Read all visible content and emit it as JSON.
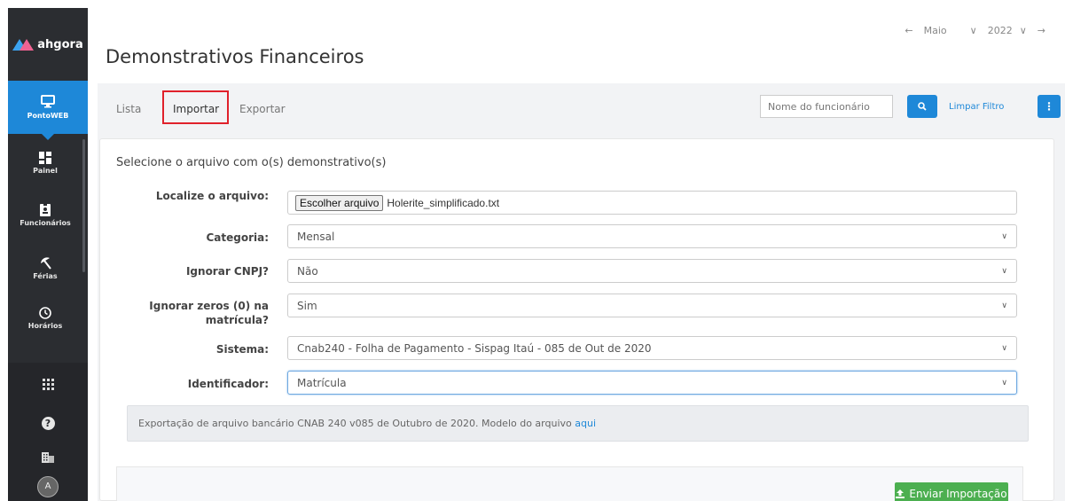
{
  "sidebar": {
    "logo_text": "ahgora",
    "active_item": {
      "label": "PontoWEB",
      "icon": "monitor-icon"
    },
    "items": [
      {
        "label": "Painel",
        "icon": "dashboard-icon"
      },
      {
        "label": "Funcionários",
        "icon": "badge-icon"
      },
      {
        "label": "Férias",
        "icon": "beach-umbrella-icon"
      },
      {
        "label": "Horários",
        "icon": "clock-icon"
      }
    ],
    "bottom_icons": [
      "apps-grid-icon",
      "help-icon",
      "building-icon",
      "avatar"
    ],
    "avatar_initial": "A"
  },
  "header": {
    "title": "Demonstrativos Financeiros",
    "period": {
      "month": "Maio",
      "year": "2022"
    }
  },
  "tabs": {
    "lista": "Lista",
    "importar": "Importar",
    "exportar": "Exportar"
  },
  "toolbar": {
    "search_placeholder": "Nome do funcionário",
    "clear_filter": "Limpar Filtro"
  },
  "form": {
    "title": "Selecione o arquivo com o(s) demonstrativo(s)",
    "file": {
      "label": "Localize o arquivo:",
      "button": "Escolher arquivo",
      "filename": "Holerite_simplificado.txt"
    },
    "categoria": {
      "label": "Categoria:",
      "value": "Mensal"
    },
    "ignorar_cnpj": {
      "label": "Ignorar CNPJ?",
      "value": "Não"
    },
    "ignorar_zeros": {
      "label_line1": "Ignorar zeros (0) na",
      "label_line2": "matrícula?",
      "value": "Sim"
    },
    "sistema": {
      "label": "Sistema:",
      "value": "Cnab240 - Folha de Pagamento - Sispag Itaú - 085 de Out de 2020"
    },
    "identificador": {
      "label": "Identificador:",
      "value": "Matrícula"
    }
  },
  "info": {
    "text": "Exportação de arquivo bancário CNAB 240 v085 de Outubro de 2020. Modelo do arquivo ",
    "link": "aqui"
  },
  "actions": {
    "send": "Enviar Importação"
  },
  "colors": {
    "primary": "#1e88d8",
    "sidebar_bg": "#2b2d31",
    "success": "#4caf50",
    "highlight": "#e0212b"
  }
}
